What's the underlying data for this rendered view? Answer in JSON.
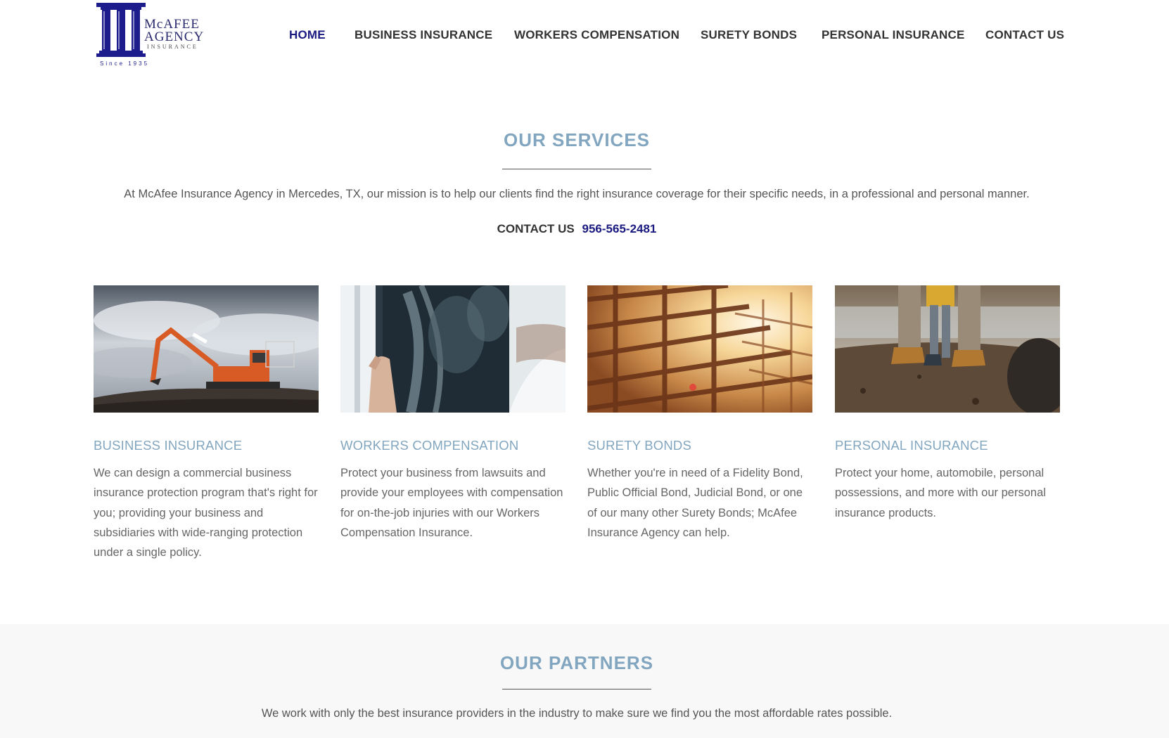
{
  "logo": {
    "letter": "m",
    "word1": "McAFEE",
    "word2": "AGENCY",
    "word3": "INSURANCE",
    "since": "Since 1935",
    "color": "#1c1c8c"
  },
  "nav": {
    "items": [
      {
        "label": "HOME",
        "active": true
      },
      {
        "label": "BUSINESS INSURANCE",
        "active": false
      },
      {
        "label": "WORKERS COMPENSATION",
        "active": false
      },
      {
        "label": "SURETY BONDS",
        "active": false
      },
      {
        "label": "PERSONAL INSURANCE",
        "active": false
      },
      {
        "label": "CONTACT US",
        "active": false
      }
    ]
  },
  "services": {
    "title": "OUR SERVICES",
    "intro": "At McAfee Insurance Agency in Mercedes, TX, our mission is to help our clients find the right insurance coverage for their specific needs, in a professional and personal manner.",
    "contact_label": "CONTACT US",
    "phone": "956-565-2481",
    "cards": [
      {
        "image": "excavator-photo",
        "title": "BUSINESS INSURANCE",
        "text": "We can design a commercial business insurance protection program that's right for you; providing your business and subsidiaries with wide-ranging protection under a single policy."
      },
      {
        "image": "x-ray-photo",
        "title": "WORKERS COMPENSATION",
        "text": "Protect your business from lawsuits and provide your employees with compensation for on-the-job injuries with our Workers Compensation Insurance."
      },
      {
        "image": "steel-frame-photo",
        "title": "SURETY BONDS",
        "text": "Whether you're in need of a Fidelity Bond, Public Official Bond, Judicial Bond, or one of our many other Surety Bonds; McAfee Insurance Agency can help."
      },
      {
        "image": "family-boots-photo",
        "title": "PERSONAL INSURANCE",
        "text": "Protect your home, automobile, personal possessions, and more with our personal insurance products."
      }
    ]
  },
  "partners": {
    "title": "OUR PARTNERS",
    "intro": "We work with only the best insurance providers in the industry to make sure we find you the most affordable rates possible."
  },
  "colors": {
    "accent": "#82a6bf",
    "brand": "#1a1a80",
    "text": "#555555"
  }
}
